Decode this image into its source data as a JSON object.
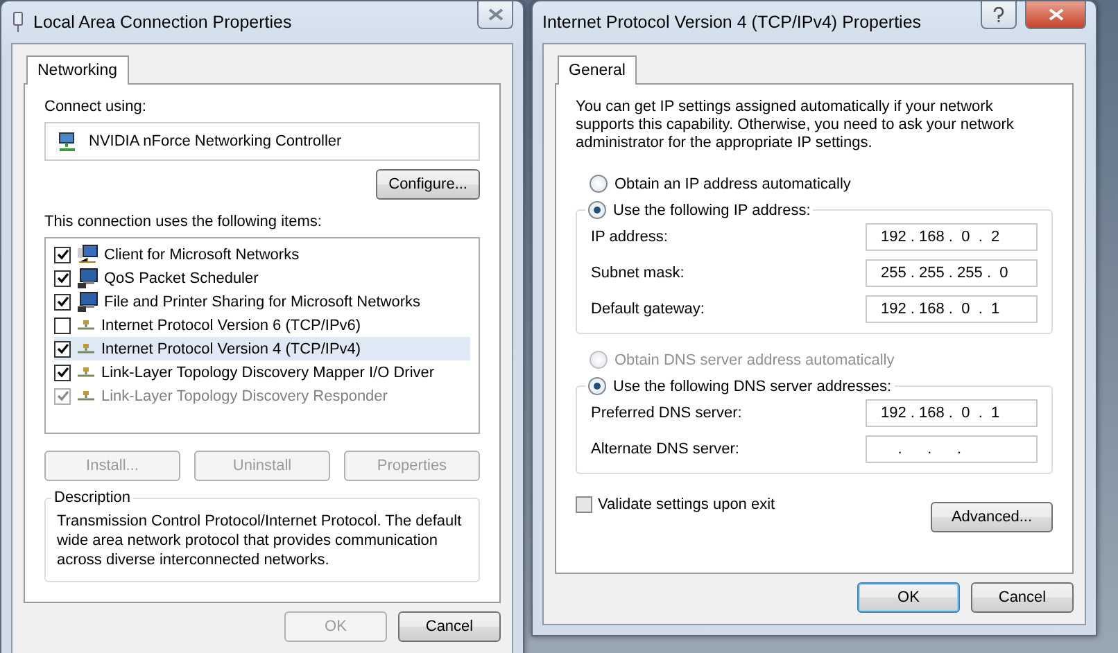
{
  "lan_dialog": {
    "title": "Local Area Connection Properties",
    "tabs": [
      {
        "label": "Networking",
        "selected": true
      }
    ],
    "connect_label": "Connect using:",
    "adapter": "NVIDIA nForce Networking Controller",
    "configure_button": "Configure...",
    "items_label": "This connection uses the following items:",
    "items": [
      {
        "label": "Client for Microsoft Networks",
        "checked": true,
        "disabled": false,
        "selected": false,
        "kind": "client"
      },
      {
        "label": "QoS Packet Scheduler",
        "checked": true,
        "disabled": false,
        "selected": false,
        "kind": "service"
      },
      {
        "label": "File and Printer Sharing for Microsoft Networks",
        "checked": true,
        "disabled": false,
        "selected": false,
        "kind": "service"
      },
      {
        "label": "Internet Protocol Version 6 (TCP/IPv6)",
        "checked": false,
        "disabled": false,
        "selected": false,
        "kind": "protocol"
      },
      {
        "label": "Internet Protocol Version 4 (TCP/IPv4)",
        "checked": true,
        "disabled": false,
        "selected": true,
        "kind": "protocol"
      },
      {
        "label": "Link-Layer Topology Discovery Mapper I/O Driver",
        "checked": true,
        "disabled": false,
        "selected": false,
        "kind": "protocol"
      },
      {
        "label": "Link-Layer Topology Discovery Responder",
        "checked": true,
        "disabled": true,
        "selected": false,
        "kind": "protocol"
      }
    ],
    "buttons": [
      {
        "label": "Install...",
        "disabled": true
      },
      {
        "label": "Uninstall",
        "disabled": true
      },
      {
        "label": "Properties",
        "disabled": true
      }
    ],
    "description_label": "Description",
    "description": "Transmission Control Protocol/Internet Protocol. The default wide area network protocol that provides communication across diverse interconnected networks.",
    "footer_buttons": [
      {
        "label": "OK",
        "disabled": true
      },
      {
        "label": "Cancel",
        "disabled": false
      }
    ]
  },
  "ipv4_dialog": {
    "title": "Internet Protocol Version 4 (TCP/IPv4) Properties",
    "tabs": [
      {
        "label": "General",
        "selected": true
      }
    ],
    "intro": "You can get IP settings assigned automatically if your network supports this capability. Otherwise, you need to ask your network administrator for the appropriate IP settings.",
    "ip_radios": [
      {
        "label": "Obtain an IP address automatically",
        "selected": false,
        "disabled": false
      },
      {
        "label": "Use the following IP address:",
        "selected": true,
        "disabled": false
      }
    ],
    "ip_fields": [
      {
        "label": "IP address:",
        "value": "192 . 168 .  0  .  2"
      },
      {
        "label": "Subnet mask:",
        "value": "255 . 255 . 255 .  0"
      },
      {
        "label": "Default gateway:",
        "value": "192 . 168 .  0  .  1"
      }
    ],
    "dns_radios": [
      {
        "label": "Obtain DNS server address automatically",
        "selected": false,
        "disabled": true
      },
      {
        "label": "Use the following DNS server addresses:",
        "selected": true,
        "disabled": false
      }
    ],
    "dns_fields": [
      {
        "label": "Preferred DNS server:",
        "value": "192 . 168 .  0  .  1"
      },
      {
        "label": "Alternate DNS server:",
        "value": "    .      .      .    "
      }
    ],
    "validate": {
      "label": "Validate settings upon exit",
      "checked": false
    },
    "advanced_button": "Advanced...",
    "footer_buttons": [
      {
        "label": "OK",
        "default": true
      },
      {
        "label": "Cancel",
        "default": false
      }
    ]
  }
}
